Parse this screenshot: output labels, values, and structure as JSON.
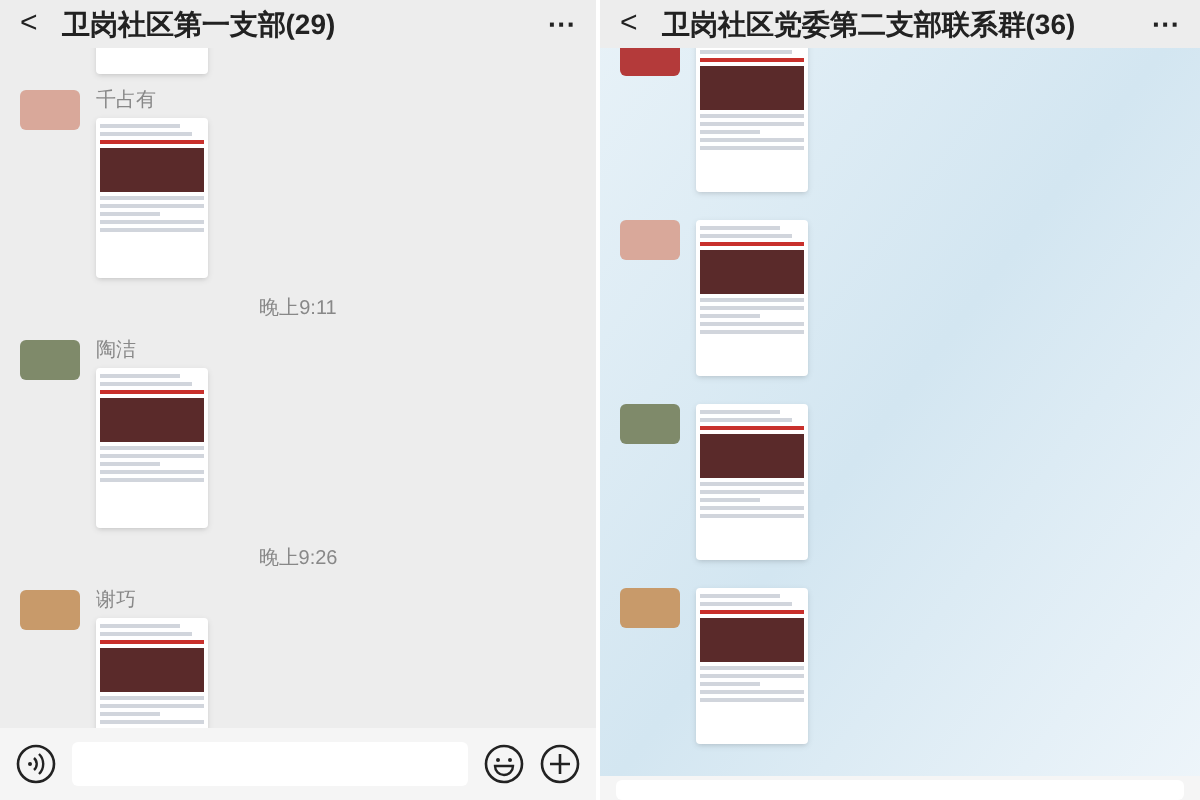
{
  "panels": [
    {
      "title": "卫岗社区第一支部(29)",
      "back": "<",
      "more": "···",
      "messages": [
        {
          "kind": "article"
        },
        {
          "kind": "article",
          "sender": "千占有"
        },
        {
          "kind": "time",
          "text": "晚上9:11"
        },
        {
          "kind": "article",
          "sender": "陶洁"
        },
        {
          "kind": "time",
          "text": "晚上9:26"
        },
        {
          "kind": "article",
          "sender": "谢巧"
        }
      ]
    },
    {
      "title": "卫岗社区党委第二支部联系群(36)",
      "back": "<",
      "more": "···",
      "messages": [
        {
          "kind": "article"
        },
        {
          "kind": "article"
        },
        {
          "kind": "article"
        },
        {
          "kind": "article"
        }
      ]
    }
  ]
}
